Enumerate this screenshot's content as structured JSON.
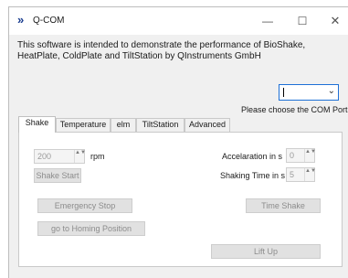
{
  "window": {
    "title": "Q-COM",
    "logo_glyph": "»",
    "controls": {
      "minimize": "—",
      "maximize": "☐",
      "close": "✕"
    }
  },
  "intro_text": "This software is intended to demonstrate the performance of BioShake, HeatPlate, ColdPlate and TiltStation by QInstruments GmbH",
  "com_port": {
    "selected_value": "",
    "arrow": "⌄",
    "hint": "Please choose the COM Port"
  },
  "tabs": [
    "Shake",
    "Temperature",
    "elm",
    "TiltStation",
    "Advanced"
  ],
  "active_tab": "Shake",
  "shake_panel": {
    "rpm_value": "200",
    "rpm_unit": "rpm",
    "acceleration_label": "Accelaration in s",
    "acceleration_value": "0",
    "shaking_time_label": "Shaking Time in s",
    "shaking_time_value": "5",
    "spin_arrows": "▲▼",
    "buttons": {
      "shake_start": "Shake Start",
      "emergency_stop": "Emergency Stop",
      "time_shake": "Time Shake",
      "homing": "go to Homing Position",
      "lift_up": "Lift Up"
    }
  }
}
